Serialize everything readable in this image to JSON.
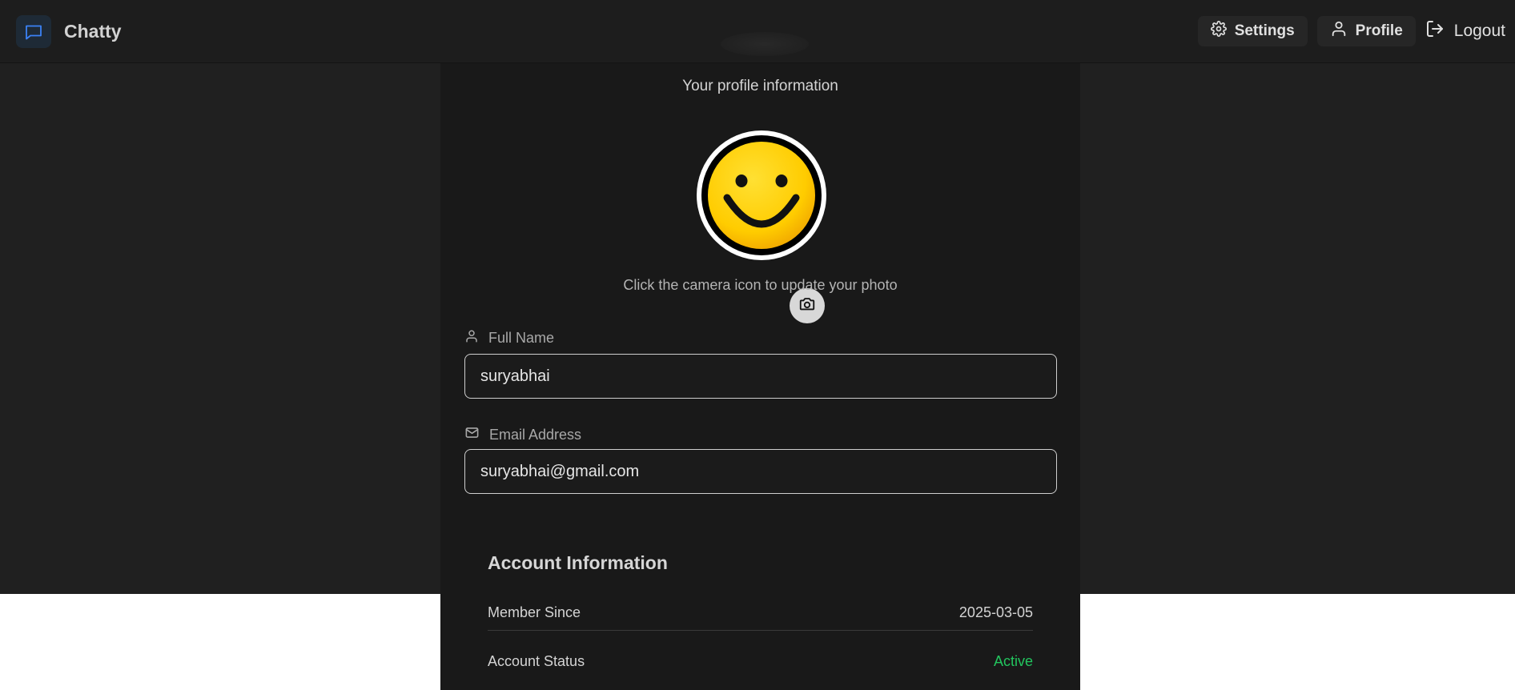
{
  "app": {
    "name": "Chatty",
    "brand_icon": "message-square-icon",
    "accent_color": "#3b82f6"
  },
  "nav": {
    "settings_label": "Settings",
    "profile_label": "Profile",
    "logout_label": "Logout"
  },
  "profile": {
    "subtitle": "Your profile information",
    "avatar_hint": "Click the camera icon to update your photo",
    "full_name": {
      "label": "Full Name",
      "value": "suryabhai",
      "icon": "user-icon"
    },
    "email": {
      "label": "Email Address",
      "value": "suryabhai@gmail.com",
      "icon": "mail-icon"
    }
  },
  "account": {
    "title": "Account Information",
    "rows": [
      {
        "label": "Member Since",
        "value": "2025-03-05"
      },
      {
        "label": "Account Status",
        "value": "Active"
      }
    ],
    "status_color": "#22c55e"
  }
}
